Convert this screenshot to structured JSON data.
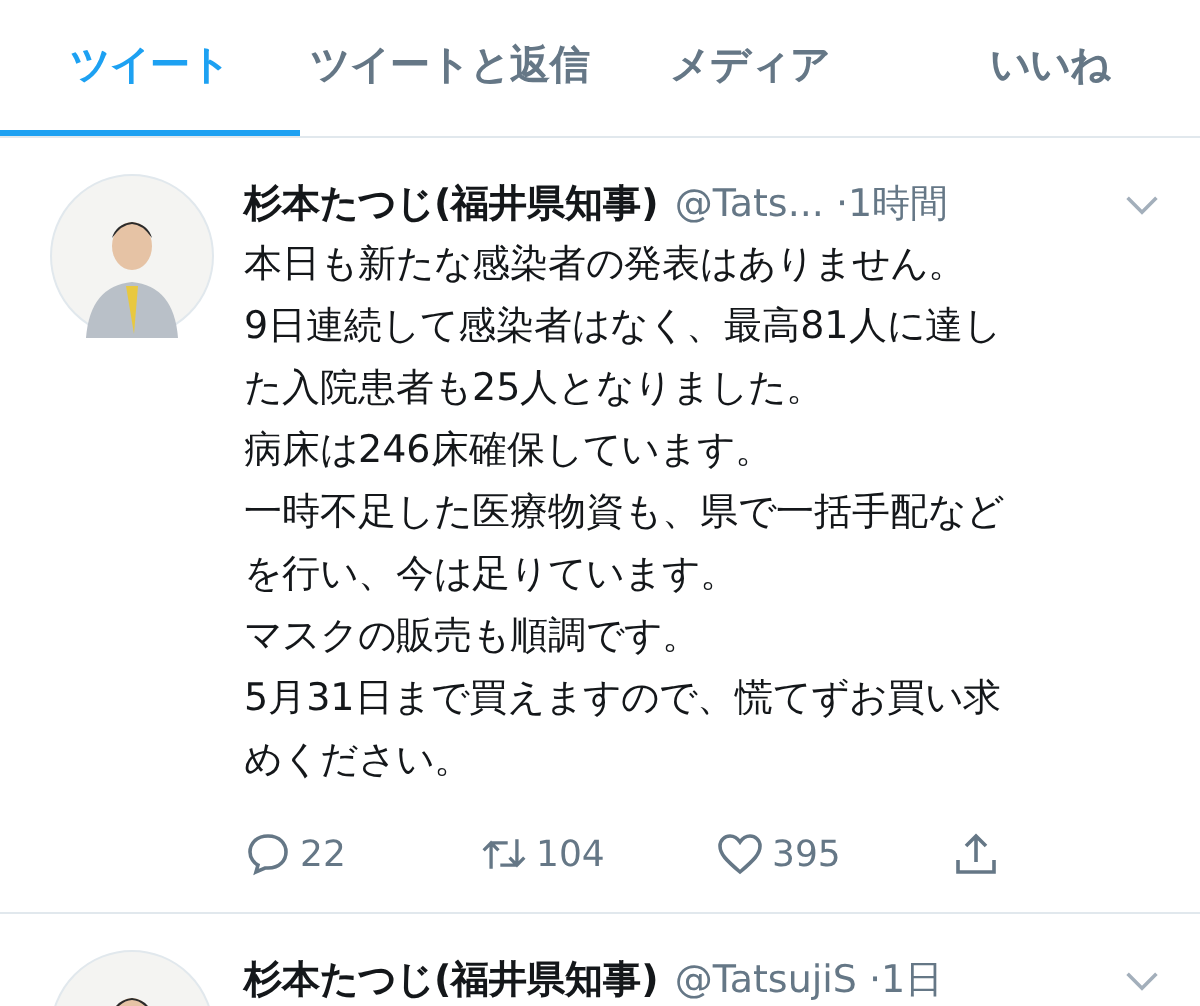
{
  "tabs": [
    {
      "label": "ツイート",
      "selected": true
    },
    {
      "label": "ツイートと返信",
      "selected": false
    },
    {
      "label": "メディア",
      "selected": false
    },
    {
      "label": "いいね",
      "selected": false
    }
  ],
  "tweets": [
    {
      "name": "杉本たつじ(福井県知事)",
      "handle": "@Tats...",
      "time": "·1時間",
      "body": [
        "本日も新たな感染者の発表はありません。",
        "9日連続して感染者はなく、最高81人に達した入院患者も25人となりました。",
        "病床は246床確保しています。",
        "一時不足した医療物資も、県で一括手配などを行い、今は足りています。",
        "マスクの販売も順調です。",
        "5月31日まで買えますので、慌てずお買い求めください。"
      ],
      "replies": "22",
      "retweets": "104",
      "likes": "395"
    },
    {
      "name": "杉本たつじ(福井県知事)",
      "handle": "@TatsujiS",
      "time": "·1日"
    }
  ]
}
